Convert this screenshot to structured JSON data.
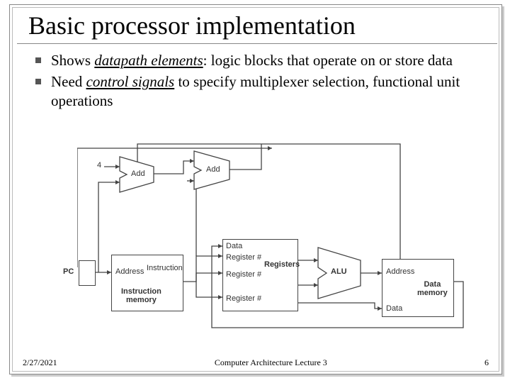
{
  "title": "Basic processor implementation",
  "bullets": [
    {
      "pre": "Shows ",
      "em": "datapath elements",
      "post": ": logic blocks that operate on or store data"
    },
    {
      "pre": "Need ",
      "em": "control signals",
      "post": " to specify multiplexer selection, functional unit operations"
    }
  ],
  "footer": {
    "date": "2/27/2021",
    "center": "Computer Architecture Lecture 3",
    "page": "6"
  },
  "diag": {
    "pc": "PC",
    "four": "4",
    "add1": "Add",
    "add2": "Add",
    "imem_addr": "Address",
    "imem_inst": "Instruction",
    "imem": "Instruction\nmemory",
    "reg_r1": "Register #",
    "reg_r2": "Register #",
    "reg_r3": "Register #",
    "reg_data": "Data",
    "registers": "Registers",
    "alu": "ALU",
    "dmem_addr": "Address",
    "dmem_data": "Data",
    "dmem": "Data\nmemory"
  }
}
